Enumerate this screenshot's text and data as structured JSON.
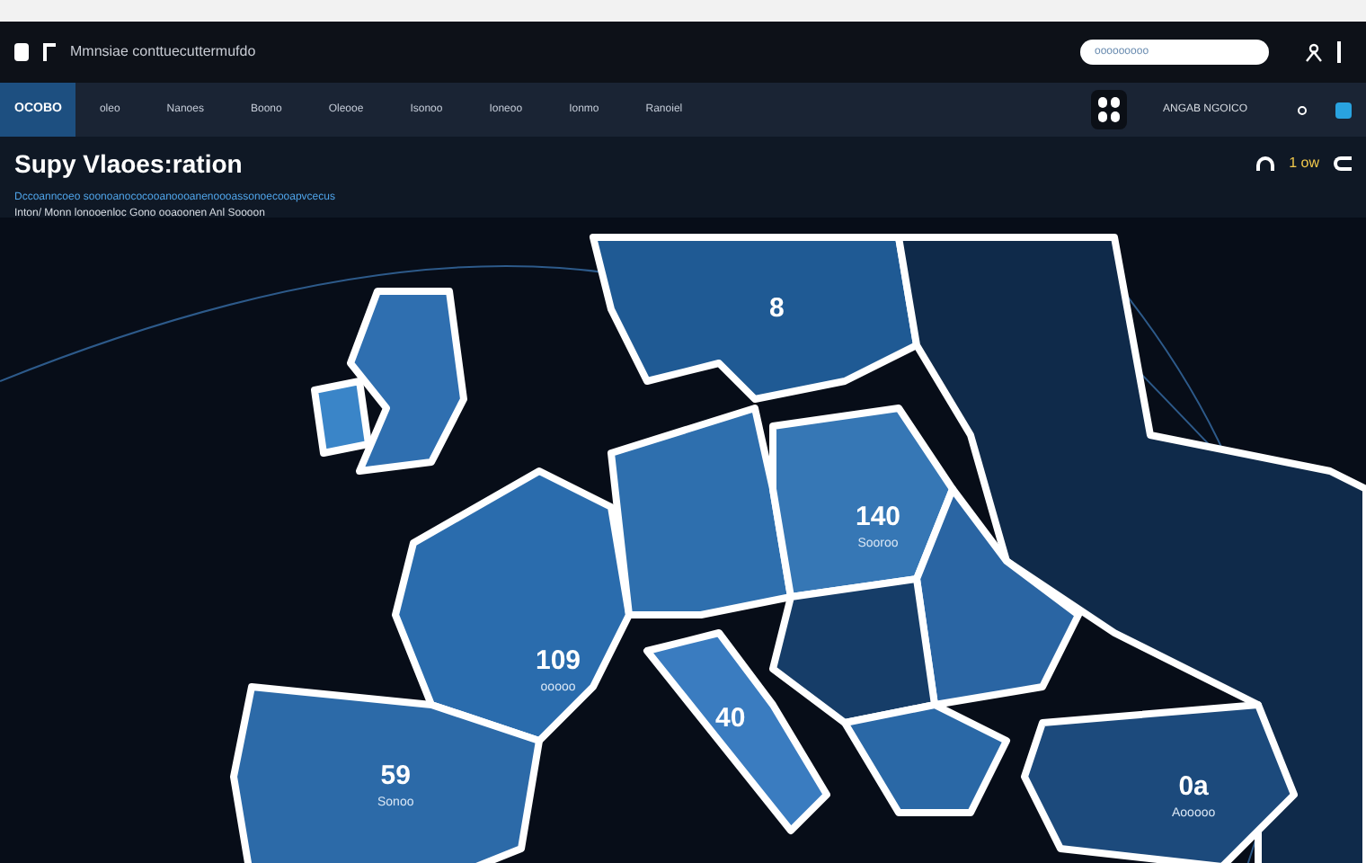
{
  "header": {
    "title": "Mmnsiae conttuecuttermufdo",
    "search": {
      "placeholder": "ooooooooo"
    }
  },
  "nav": {
    "items": [
      {
        "label": "OCOBO",
        "selected": true
      },
      {
        "label": "oleo",
        "selected": false
      },
      {
        "label": "Nanoes",
        "selected": false
      },
      {
        "label": "Boono",
        "selected": false
      },
      {
        "label": "Oleooe",
        "selected": false
      },
      {
        "label": "Isonoo",
        "selected": false
      },
      {
        "label": "Ioneoo",
        "selected": false
      },
      {
        "label": "Ionmo",
        "selected": false
      },
      {
        "label": "Ranoiel",
        "selected": false
      }
    ],
    "account": "ANGAB NGOICO"
  },
  "page": {
    "title": "Supy Vlaoes:ration",
    "subtitle": "Dccoanncoeo soonoanococooanoooanenoooassonoecooapvcecus",
    "description": "Inton/ Monn lonooenloc Gono ooaoonen Anl Soooon",
    "counter": "1 ow"
  },
  "map": {
    "labels": [
      {
        "value": "8"
      },
      {
        "value": "140",
        "caption": "Sooroo"
      },
      {
        "value": "109",
        "caption": "ooooo"
      },
      {
        "value": "40"
      },
      {
        "value": "59",
        "caption": "Sonoo"
      },
      {
        "value": "0a",
        "caption": "Aooooo"
      }
    ]
  }
}
